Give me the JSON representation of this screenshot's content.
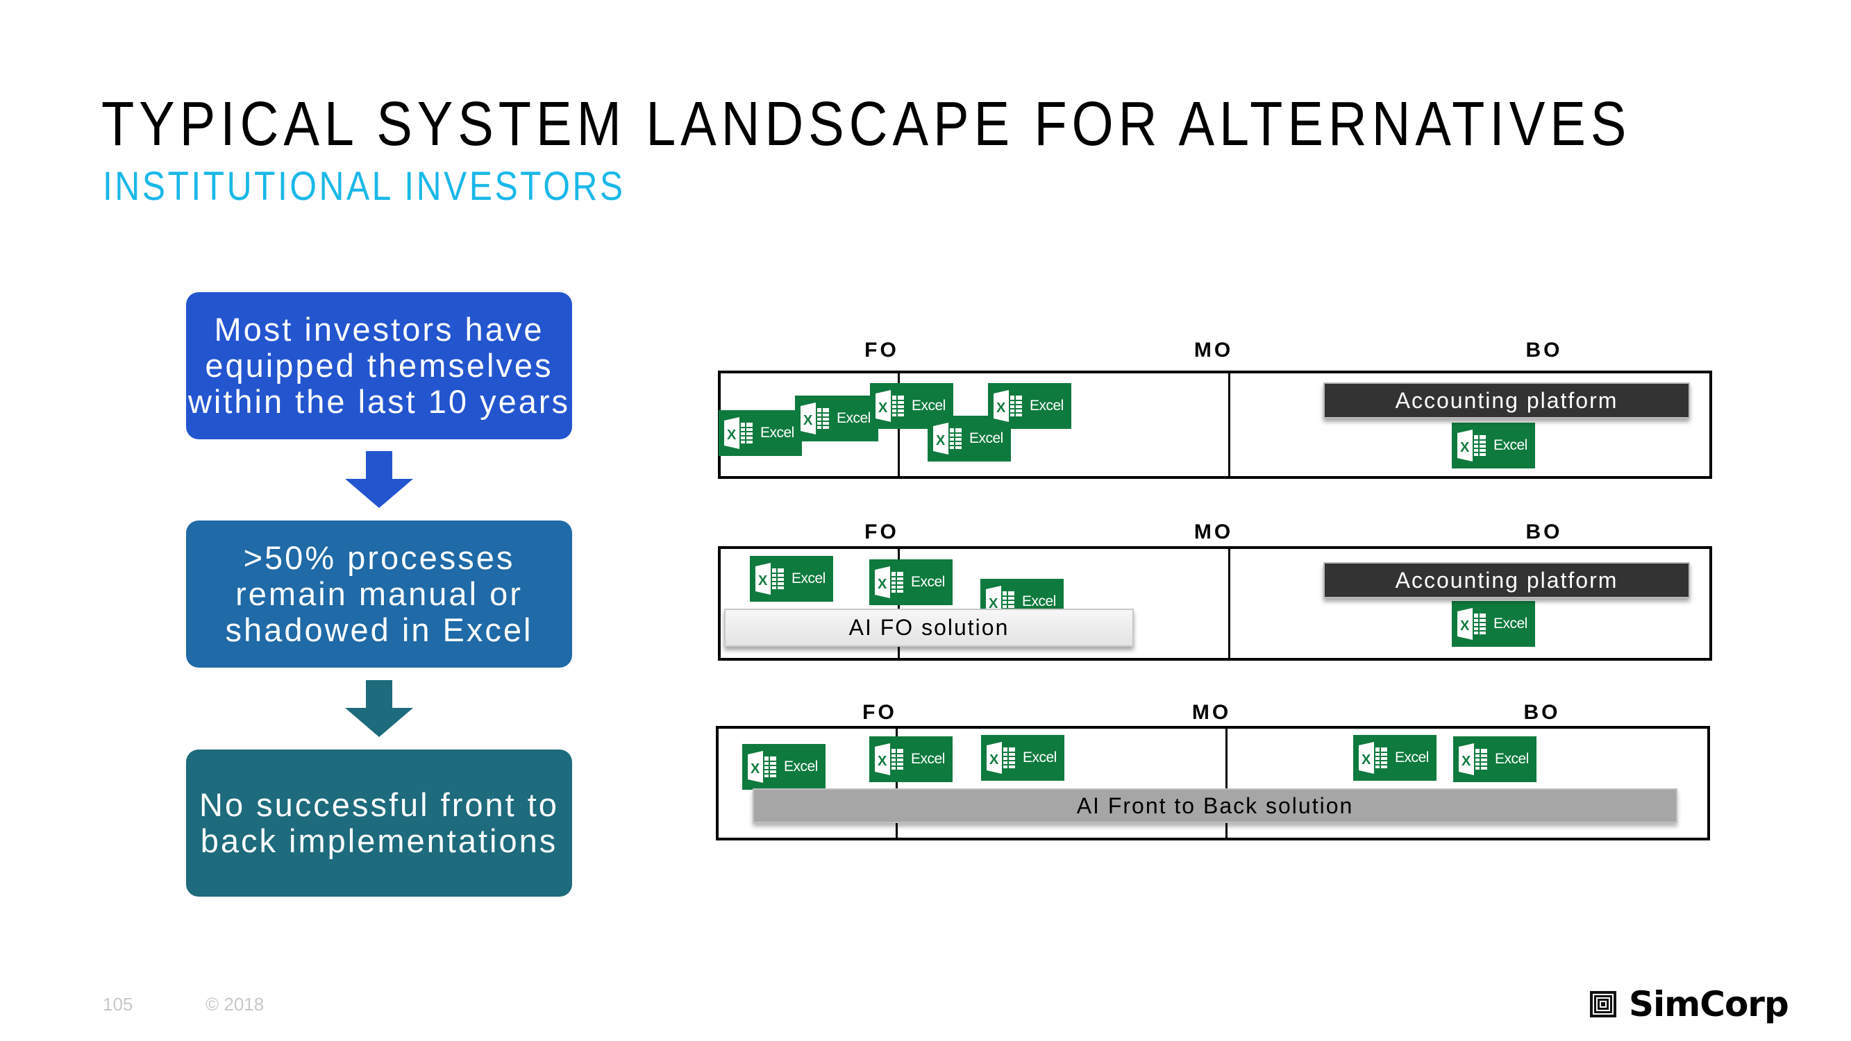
{
  "header": {
    "title": "TYPICAL SYSTEM LANDSCAPE FOR ALTERNATIVES",
    "subtitle": "INSTITUTIONAL INVESTORS"
  },
  "flow": {
    "steps": [
      {
        "lines": [
          "Most investors have",
          "equipped themselves",
          "within the last 10 years"
        ],
        "color": "#2355cf"
      },
      {
        "lines": [
          ">50% processes",
          "remain manual or",
          "shadowed in Excel"
        ],
        "color": "#1f6aa7"
      },
      {
        "lines": [
          "No successful front to",
          "back implementations"
        ],
        "color": "#1d6b7c"
      }
    ],
    "arrow_colors": [
      "#2355cf",
      "#1d6b7c"
    ]
  },
  "lanes": {
    "columns": [
      "FO",
      "MO",
      "BO"
    ],
    "excel_label": "Excel",
    "excel_color": "#0f7a3e",
    "rows": [
      {
        "excel_count": 6,
        "platform": "Accounting platform"
      },
      {
        "excel_count": 4,
        "platform": "Accounting platform",
        "solution": "AI FO solution"
      },
      {
        "excel_count": 5,
        "solution": "AI Front to Back solution"
      }
    ]
  },
  "footer": {
    "page_number": "105",
    "copyright": "© 2018",
    "brand": "SimCorp"
  }
}
